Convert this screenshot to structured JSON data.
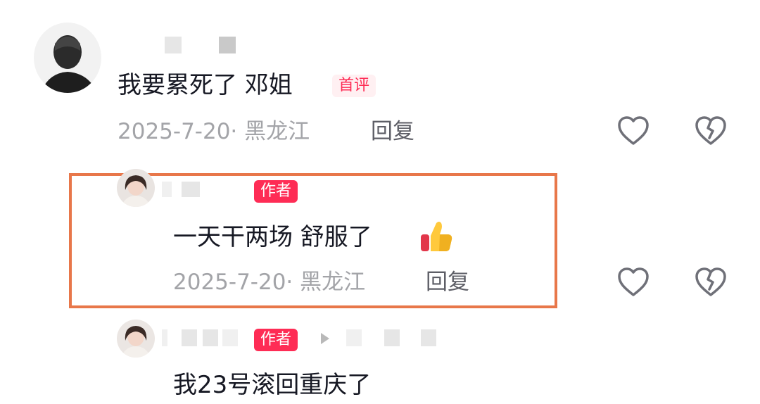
{
  "comments": [
    {
      "text": "我要累死了 邓姐",
      "badge": "首评",
      "meta": "2025-7-20· 黑龙江",
      "reply_label": "回复",
      "like_icon": "heart-outline-icon",
      "dislike_icon": "broken-heart-icon"
    },
    {
      "text": "一天干两场 舒服了",
      "badge": "作者",
      "emoji_icon": "thumbs-up-icon",
      "meta": "2025-7-20· 黑龙江",
      "reply_label": "回复",
      "like_icon": "heart-outline-icon",
      "dislike_icon": "broken-heart-icon"
    },
    {
      "text": "我23号滚回重庆了",
      "badge": "作者",
      "reply_arrow_icon": "play-arrow-icon"
    }
  ],
  "colors": {
    "accent": "#fe2c55",
    "highlight_border": "#e8774a",
    "meta_text": "#a3a4a8",
    "body_text": "#161823"
  }
}
